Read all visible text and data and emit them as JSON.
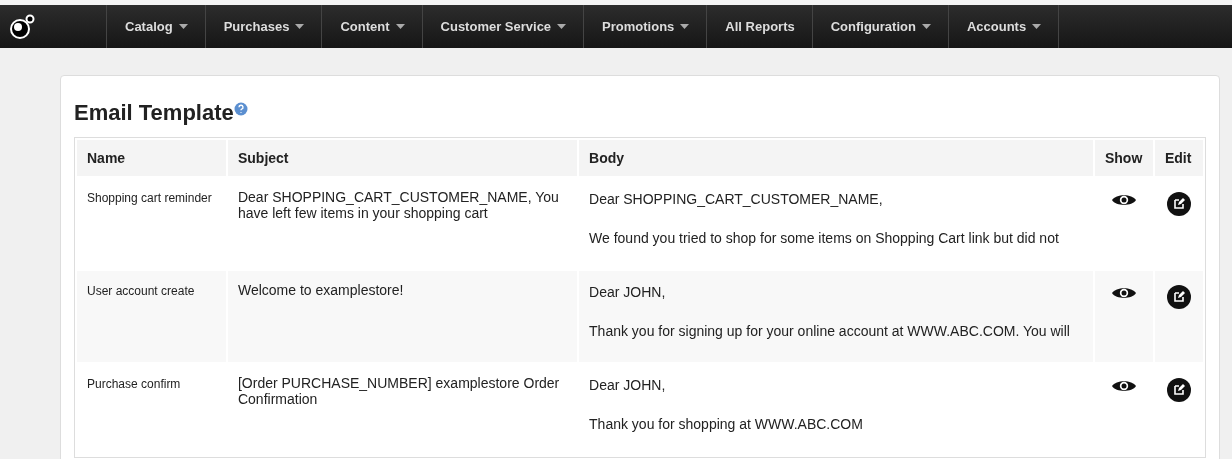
{
  "nav": {
    "items": [
      {
        "label": "Catalog",
        "dropdown": true
      },
      {
        "label": "Purchases",
        "dropdown": true
      },
      {
        "label": "Content",
        "dropdown": true
      },
      {
        "label": "Customer Service",
        "dropdown": true
      },
      {
        "label": "Promotions",
        "dropdown": true
      },
      {
        "label": "All Reports",
        "dropdown": false
      },
      {
        "label": "Configuration",
        "dropdown": true
      },
      {
        "label": "Accounts",
        "dropdown": true
      }
    ]
  },
  "page": {
    "title": "Email Template"
  },
  "table": {
    "columns": [
      "Name",
      "Subject",
      "Body",
      "Show",
      "Edit"
    ],
    "rows": [
      {
        "name": "Shopping cart reminder",
        "subject": "Dear SHOPPING_CART_CUSTOMER_NAME, You have left few items in your shopping cart",
        "body": [
          "Dear SHOPPING_CART_CUSTOMER_NAME,",
          "We found you tried to shop for some items on Shopping Cart link but did not"
        ]
      },
      {
        "name": "User account create",
        "subject": "Welcome to examplestore!",
        "body": [
          "Dear JOHN,",
          "Thank you for signing up for your online account at WWW.ABC.COM. You will"
        ]
      },
      {
        "name": "Purchase confirm",
        "subject": "[Order PURCHASE_NUMBER] examplestore Order Confirmation",
        "body": [
          "Dear JOHN,",
          "Thank you for shopping at WWW.ABC.COM"
        ]
      }
    ]
  }
}
